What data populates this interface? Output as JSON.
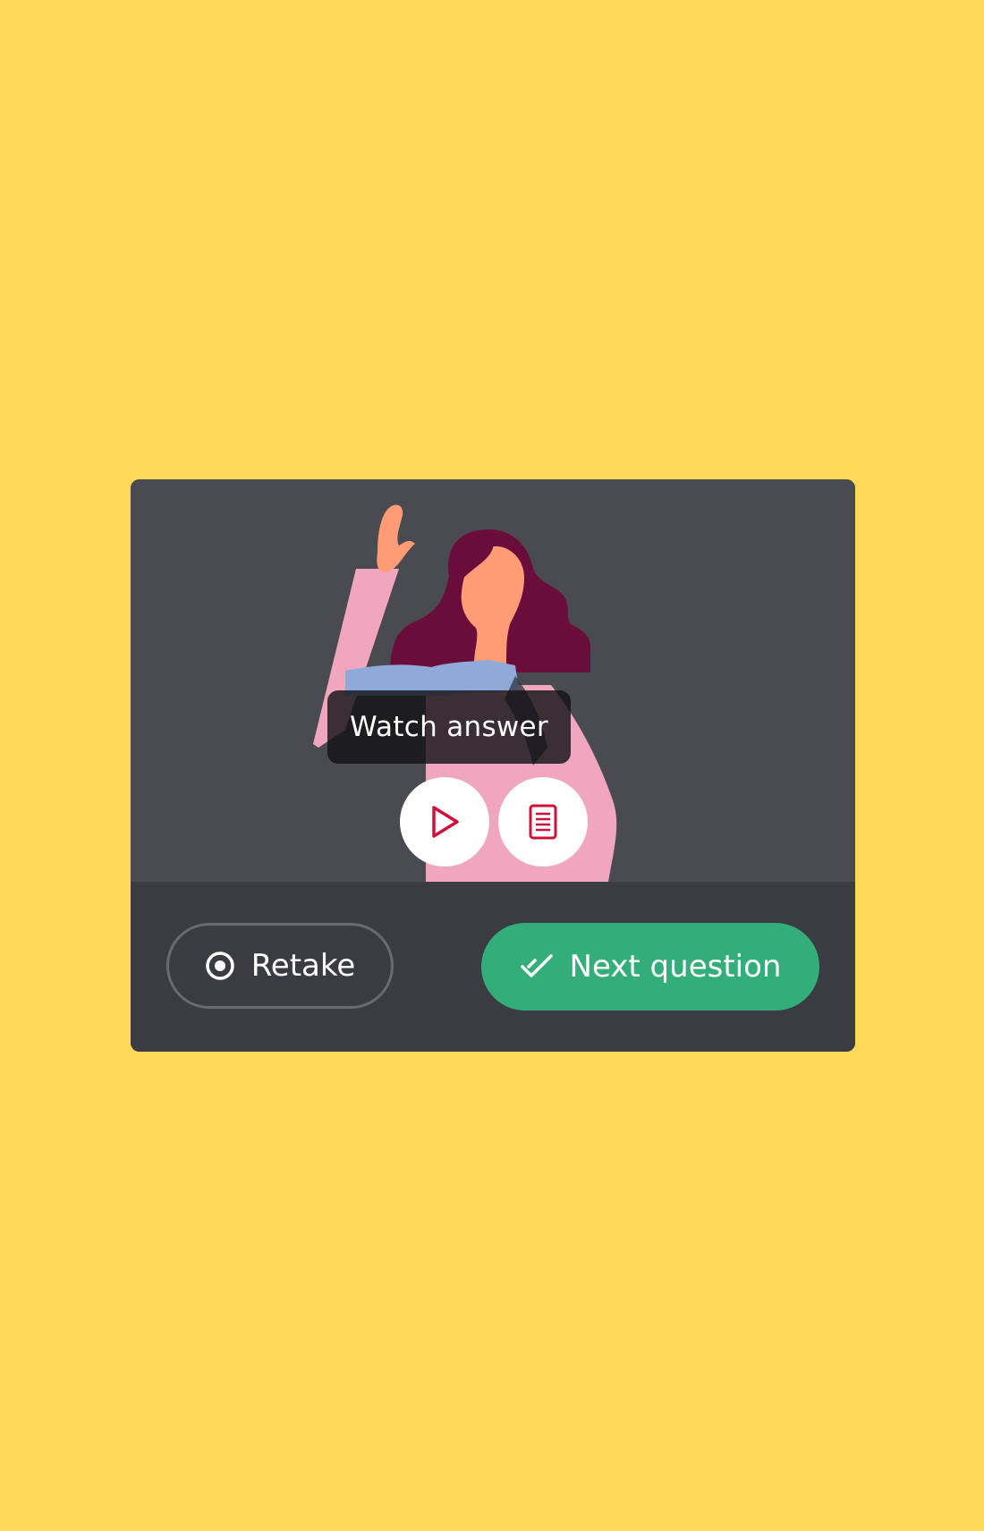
{
  "video": {
    "tooltip": "Watch answer",
    "play_icon": "play-icon",
    "transcript_icon": "transcript-icon"
  },
  "footer": {
    "retake_label": "Retake",
    "retake_icon": "record-icon",
    "next_label": "Next question",
    "next_icon": "double-check-icon"
  },
  "colors": {
    "background": "#FFD85A",
    "card": "#4A4B50",
    "footer": "#3B3C41",
    "accent_green": "#33AE7A",
    "icon_red": "#D0103A"
  }
}
